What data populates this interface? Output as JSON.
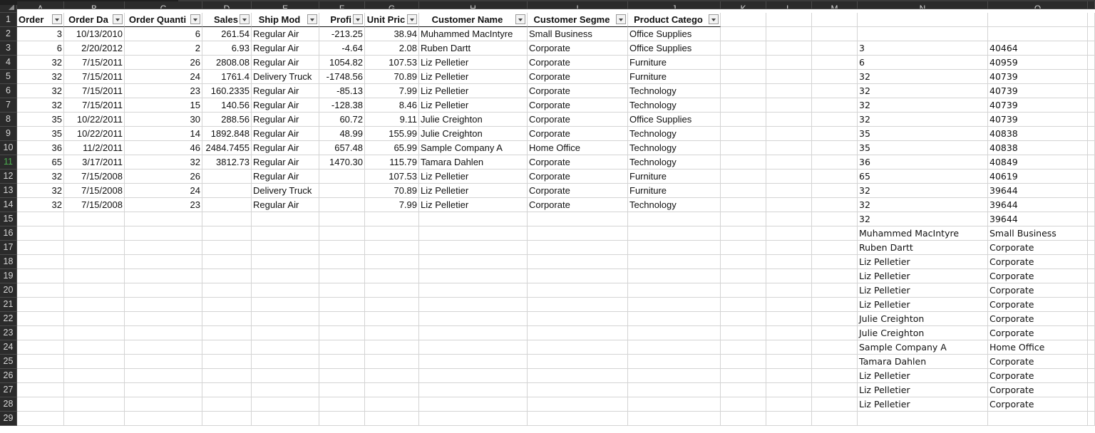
{
  "columns": [
    "A",
    "B",
    "C",
    "D",
    "E",
    "F",
    "G",
    "H",
    "I",
    "J",
    "K",
    "L",
    "M",
    "N",
    "O",
    ""
  ],
  "row_numbers": [
    "1",
    "2",
    "3",
    "4",
    "5",
    "6",
    "7",
    "8",
    "9",
    "10",
    "11",
    "12",
    "13",
    "14",
    "15",
    "16",
    "17",
    "18",
    "19",
    "20",
    "21",
    "22",
    "23",
    "24",
    "25",
    "26",
    "27",
    "28",
    "29"
  ],
  "selected_row": "11",
  "table_headers": [
    "Order",
    "Order Da",
    "Order Quanti",
    "Sales",
    "Ship Mod",
    "Profi",
    "Unit Pric",
    "Customer Name",
    "Customer Segme",
    "Product Catego"
  ],
  "table_rows": [
    [
      "3",
      "10/13/2010",
      "6",
      "261.54",
      "Regular Air",
      "-213.25",
      "38.94",
      "Muhammed MacIntyre",
      "Small Business",
      "Office Supplies"
    ],
    [
      "6",
      "2/20/2012",
      "2",
      "6.93",
      "Regular Air",
      "-4.64",
      "2.08",
      "Ruben Dartt",
      "Corporate",
      "Office Supplies"
    ],
    [
      "32",
      "7/15/2011",
      "26",
      "2808.08",
      "Regular Air",
      "1054.82",
      "107.53",
      "Liz Pelletier",
      "Corporate",
      "Furniture"
    ],
    [
      "32",
      "7/15/2011",
      "24",
      "1761.4",
      "Delivery Truck",
      "-1748.56",
      "70.89",
      "Liz Pelletier",
      "Corporate",
      "Furniture"
    ],
    [
      "32",
      "7/15/2011",
      "23",
      "160.2335",
      "Regular Air",
      "-85.13",
      "7.99",
      "Liz Pelletier",
      "Corporate",
      "Technology"
    ],
    [
      "32",
      "7/15/2011",
      "15",
      "140.56",
      "Regular Air",
      "-128.38",
      "8.46",
      "Liz Pelletier",
      "Corporate",
      "Technology"
    ],
    [
      "35",
      "10/22/2011",
      "30",
      "288.56",
      "Regular Air",
      "60.72",
      "9.11",
      "Julie Creighton",
      "Corporate",
      "Office Supplies"
    ],
    [
      "35",
      "10/22/2011",
      "14",
      "1892.848",
      "Regular Air",
      "48.99",
      "155.99",
      "Julie Creighton",
      "Corporate",
      "Technology"
    ],
    [
      "36",
      "11/2/2011",
      "46",
      "2484.7455",
      "Regular Air",
      "657.48",
      "65.99",
      "Sample Company A",
      "Home Office",
      "Technology"
    ],
    [
      "65",
      "3/17/2011",
      "32",
      "3812.73",
      "Regular Air",
      "1470.30",
      "115.79",
      "Tamara Dahlen",
      "Corporate",
      "Technology"
    ],
    [
      "32",
      "7/15/2008",
      "26",
      "",
      "Regular Air",
      "",
      "107.53",
      "Liz Pelletier",
      "Corporate",
      "Furniture"
    ],
    [
      "32",
      "7/15/2008",
      "24",
      "",
      "Delivery Truck",
      "",
      "70.89",
      "Liz Pelletier",
      "Corporate",
      "Furniture"
    ],
    [
      "32",
      "7/15/2008",
      "23",
      "",
      "Regular Air",
      "",
      "7.99",
      "Liz Pelletier",
      "Corporate",
      "Technology"
    ]
  ],
  "side_values": [
    [
      "",
      ""
    ],
    [
      "",
      ""
    ],
    [
      "3",
      "40464"
    ],
    [
      "6",
      "40959"
    ],
    [
      "32",
      "40739"
    ],
    [
      "32",
      "40739"
    ],
    [
      "32",
      "40739"
    ],
    [
      "32",
      "40739"
    ],
    [
      "35",
      "40838"
    ],
    [
      "35",
      "40838"
    ],
    [
      "36",
      "40849"
    ],
    [
      "65",
      "40619"
    ],
    [
      "32",
      "39644"
    ],
    [
      "32",
      "39644"
    ],
    [
      "32",
      "39644"
    ],
    [
      "Muhammed MacIntyre",
      "Small Business"
    ],
    [
      "Ruben Dartt",
      "Corporate"
    ],
    [
      "Liz Pelletier",
      "Corporate"
    ],
    [
      "Liz Pelletier",
      "Corporate"
    ],
    [
      "Liz Pelletier",
      "Corporate"
    ],
    [
      "Liz Pelletier",
      "Corporate"
    ],
    [
      "Julie Creighton",
      "Corporate"
    ],
    [
      "Julie Creighton",
      "Corporate"
    ],
    [
      "Sample Company A",
      "Home Office"
    ],
    [
      "Tamara Dahlen",
      "Corporate"
    ],
    [
      "Liz Pelletier",
      "Corporate"
    ],
    [
      "Liz Pelletier",
      "Corporate"
    ],
    [
      "Liz Pelletier",
      "Corporate"
    ],
    [
      "",
      ""
    ]
  ],
  "colors": {
    "header_bg": "#2b2b2b",
    "header_text": "#d6d6d6",
    "selected_row_text": "#4caf50",
    "gridline": "#d4d4d4"
  }
}
